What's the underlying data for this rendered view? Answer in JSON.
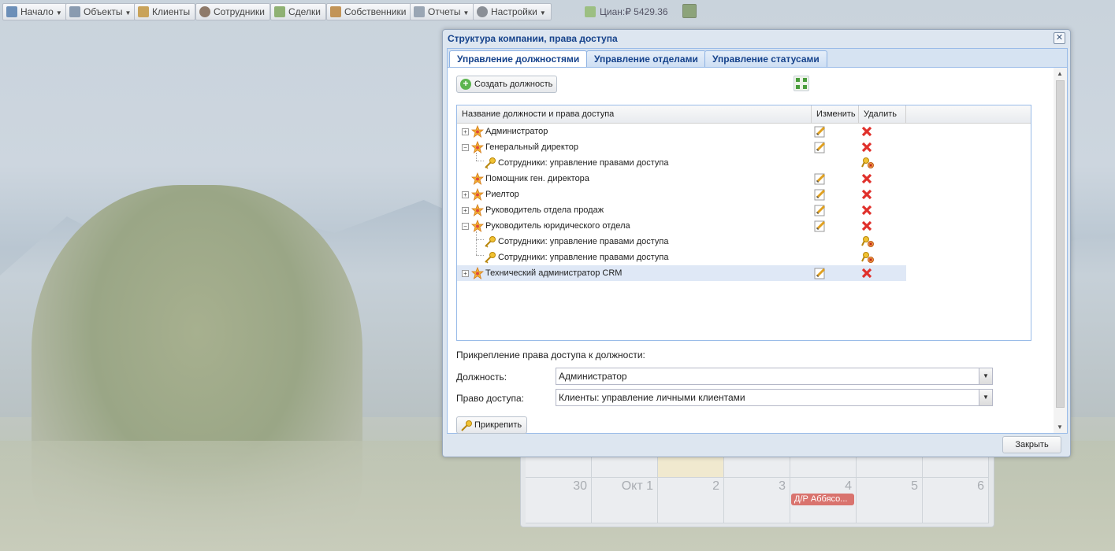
{
  "toolbar": {
    "items": [
      {
        "label": "Начало",
        "dropdown": true
      },
      {
        "label": "Объекты",
        "dropdown": true
      },
      {
        "label": "Клиенты",
        "dropdown": false
      },
      {
        "label": "Сотрудники",
        "dropdown": false
      },
      {
        "label": "Сделки",
        "dropdown": false
      },
      {
        "label": "Собственники",
        "dropdown": false
      },
      {
        "label": "Отчеты",
        "dropdown": true
      },
      {
        "label": "Настройки",
        "dropdown": true
      }
    ],
    "balance": "Циан:₽ 5429.36"
  },
  "window": {
    "title": "Структура компании, права доступа",
    "tabs": [
      "Управление должностями",
      "Управление отделами",
      "Управление статусами"
    ],
    "active_tab": 0,
    "create_button": "Создать должность",
    "grid": {
      "columns": [
        "Название должности и права доступа",
        "Изменить",
        "Удалить"
      ],
      "rows": [
        {
          "type": "position",
          "name": "Администратор",
          "expandable": true
        },
        {
          "type": "position",
          "name": "Генеральный директор",
          "expandable": true
        },
        {
          "type": "right",
          "name": "Сотрудники: управление правами доступа"
        },
        {
          "type": "position",
          "name": "Помощник ген. директора",
          "expandable": false
        },
        {
          "type": "position",
          "name": "Риелтор",
          "expandable": true
        },
        {
          "type": "position",
          "name": "Руководитель отдела продаж",
          "expandable": true
        },
        {
          "type": "position",
          "name": "Руководитель юридического отдела",
          "expandable": true
        },
        {
          "type": "right",
          "name": "Сотрудники: управление правами доступа"
        },
        {
          "type": "right",
          "name": "Сотрудники: управление правами доступа"
        },
        {
          "type": "position",
          "name": "Технический администратор CRM",
          "expandable": true,
          "selected": true
        }
      ]
    },
    "form": {
      "title": "Прикрепление права доступа к должности:",
      "position_label": "Должность:",
      "position_value": "Администратор",
      "right_label": "Право доступа:",
      "right_value": "Клиенты: управление личными клиентами",
      "attach_button": "Прикрепить"
    },
    "close_button": "Закрыть"
  },
  "calendar": {
    "days": [
      "30",
      "Окт 1",
      "2",
      "3",
      "4",
      "5",
      "6"
    ],
    "event": "Д/Р Аббясо..."
  }
}
